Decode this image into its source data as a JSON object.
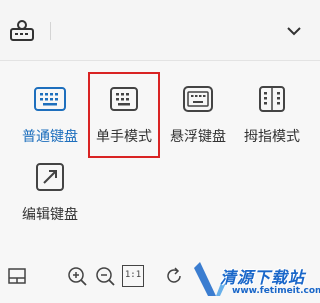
{
  "colors": {
    "accent": "#1e6fbd",
    "highlight": "#d92323",
    "icon_gray": "#444444"
  },
  "topbar": {
    "left_icon": "keyboard-logo-icon",
    "collapse_icon": "chevron-down-icon"
  },
  "modes": [
    {
      "label": "普通键盘",
      "icon": "standard-keyboard-icon",
      "active": true
    },
    {
      "label": "单手模式",
      "icon": "one-hand-keyboard-icon",
      "active": false
    },
    {
      "label": "悬浮键盘",
      "icon": "floating-keyboard-icon",
      "active": false
    },
    {
      "label": "拇指模式",
      "icon": "thumb-keyboard-icon",
      "active": false
    }
  ],
  "edit_keyboard": {
    "label": "编辑键盘",
    "icon": "resize-icon"
  },
  "bottombar": {
    "icons": [
      "layout-icon",
      "zoom-in-icon",
      "zoom-out-icon",
      "actual-size-icon",
      "rotate-icon"
    ],
    "actual_size_text": "1:1"
  },
  "watermark": {
    "text": "清源下载站",
    "url": "www.fetimeit.com"
  }
}
